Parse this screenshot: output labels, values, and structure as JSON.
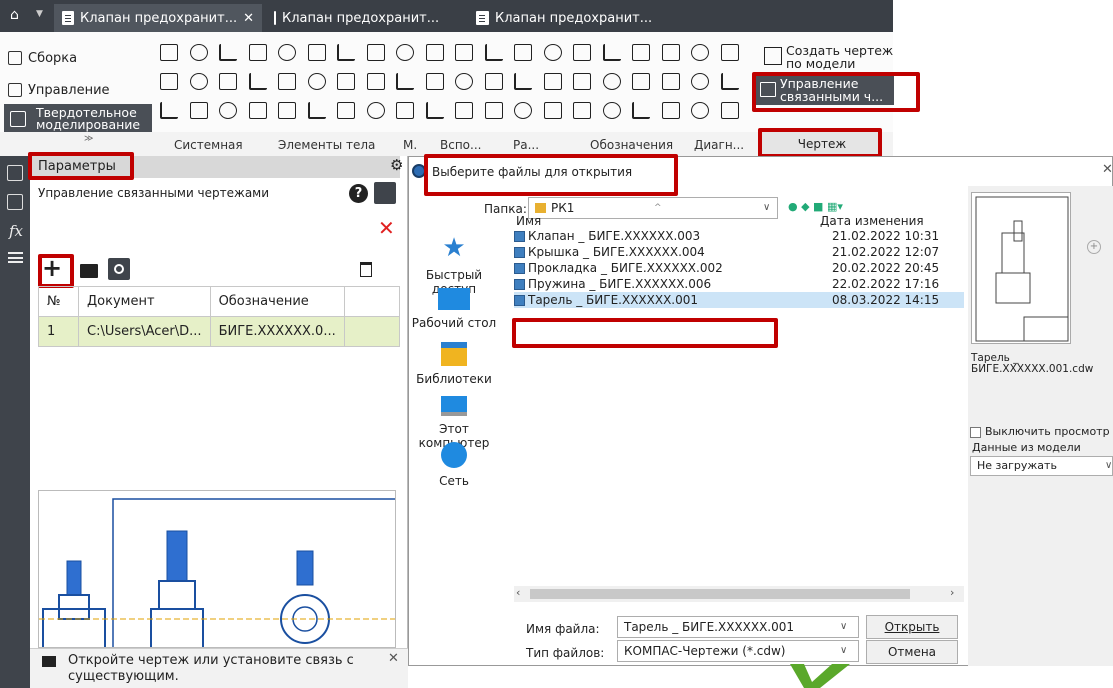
{
  "tabs": [
    {
      "label": "Клапан предохранит...",
      "active": true,
      "closable": "✕"
    },
    {
      "label": "Клапан предохранит...",
      "active": false
    },
    {
      "label": "Клапан предохранит...",
      "active": false
    }
  ],
  "ribbon": {
    "modes": [
      "Сборка",
      "Управление",
      "Твердотельное моделирование"
    ],
    "groups": [
      "Системная",
      "Элементы тела",
      "М.",
      "Вспо...",
      "Ра...",
      "Обозначения",
      "Диагн..."
    ],
    "active_group": "Чертеж",
    "create_drawing": "Создать чертеж по модели",
    "manage_linked": "Управление связанными ч..."
  },
  "params": {
    "title": "Параметры",
    "subtitle": "Управление связанными чертежами",
    "table": {
      "headers": [
        "№",
        "Документ",
        "Обозначение"
      ],
      "rows": [
        [
          "1",
          "C:\\Users\\Acer\\D...",
          "БИГЕ.XXXXXX.0..."
        ]
      ]
    },
    "hint": "Откройте чертеж или установите связь с существующим."
  },
  "dialog": {
    "title": "Выберите файлы для открытия",
    "folder_label": "Папка:",
    "folder_value": "РК1",
    "places": [
      "Быстрый доступ",
      "Рабочий стол",
      "Библиотеки",
      "Этот компьютер",
      "Сеть"
    ],
    "col_name": "Имя",
    "col_date": "Дата изменения",
    "files": [
      {
        "name": "Клапан _ БИГЕ.XXXXXX.003",
        "date": "21.02.2022 10:31"
      },
      {
        "name": "Крышка _ БИГЕ.XXXXXX.004",
        "date": "21.02.2022 12:07"
      },
      {
        "name": "Прокладка _ БИГЕ.XXXXXX.002",
        "date": "20.02.2022 20:45"
      },
      {
        "name": "Пружина _ БИГЕ.XXXXXX.006",
        "date": "22.02.2022 17:16"
      },
      {
        "name": "Тарель _ БИГЕ.XXXXXX.001",
        "date": "08.03.2022 14:15",
        "selected": true
      }
    ],
    "filename_label": "Имя файла:",
    "filename_value": "Тарель _ БИГЕ.XXXXXX.001",
    "filetype_label": "Тип файлов:",
    "filetype_value": "КОМПАС-Чертежи (*.cdw)",
    "open_btn": "Открыть",
    "cancel_btn": "Отмена",
    "preview_caption": "Тарель _ БИГЕ.XXXXXX.001.cdw",
    "disable_preview": "Выключить просмотр",
    "model_data_label": "Данные из модели",
    "model_data_value": "Не загружать"
  },
  "colors": {
    "highlight": "#c00000",
    "selection": "#cce4f7",
    "table_sel": "#e6f0c8"
  }
}
